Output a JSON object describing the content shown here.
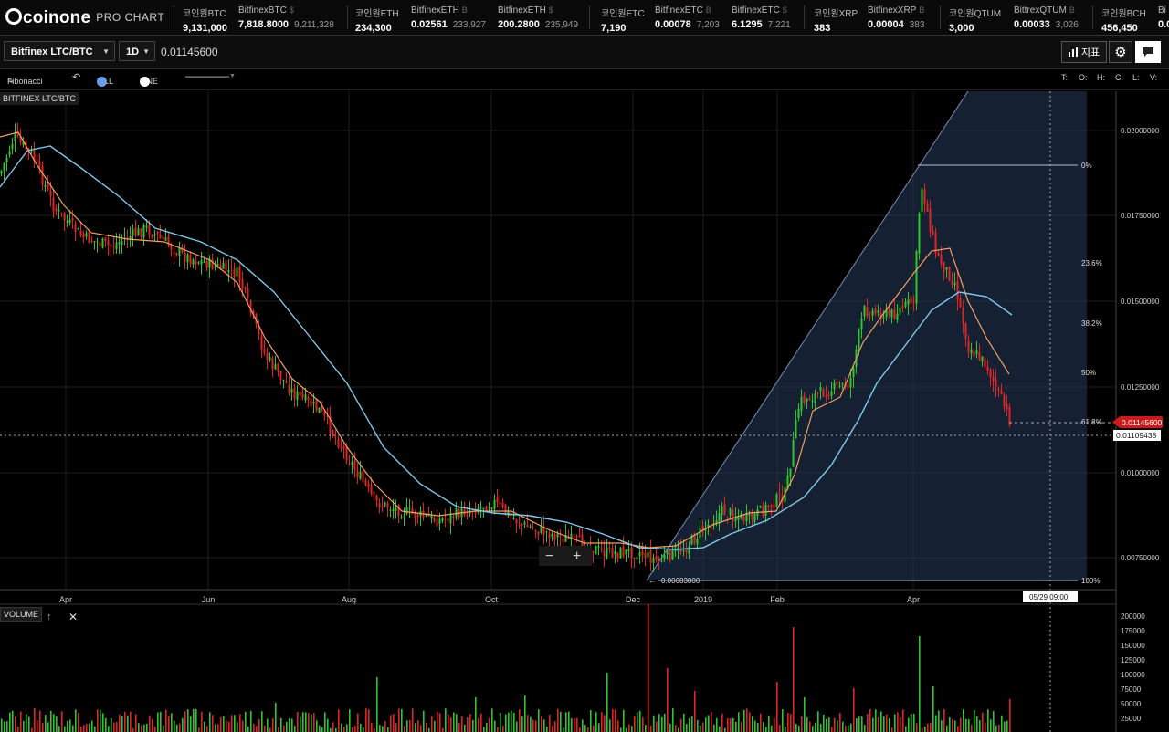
{
  "header": {
    "logo_text": "coinone",
    "logo_sub": "PRO CHART",
    "tickers": [
      {
        "name": "코인원BTC",
        "cur": "",
        "price": "9,131,000",
        "sub": ""
      },
      {
        "name": "BitfinexBTC",
        "cur": "$",
        "price": "7,818.8000",
        "sub": "9,211,328"
      },
      {
        "name": "코인원ETH",
        "cur": "",
        "price": "234,300",
        "sub": ""
      },
      {
        "name": "BitfinexETH",
        "cur": "B",
        "price": "0.02561",
        "sub": "233,927"
      },
      {
        "name": "BitfinexETH",
        "cur": "$",
        "price": "200.2800",
        "sub": "235,949"
      },
      {
        "name": "코인원ETC",
        "cur": "",
        "price": "7,190",
        "sub": ""
      },
      {
        "name": "BitfinexETC",
        "cur": "B",
        "price": "0.00078",
        "sub": "7,203"
      },
      {
        "name": "BitfinexETC",
        "cur": "$",
        "price": "6.1295",
        "sub": "7,221"
      },
      {
        "name": "코인원XRP",
        "cur": "",
        "price": "383",
        "sub": ""
      },
      {
        "name": "BitfinexXRP",
        "cur": "B",
        "price": "0.00004",
        "sub": "383"
      },
      {
        "name": "코인원QTUM",
        "cur": "",
        "price": "3,000",
        "sub": ""
      },
      {
        "name": "BittrexQTUM",
        "cur": "B",
        "price": "0.00033",
        "sub": "3,026"
      },
      {
        "name": "코인원BCH",
        "cur": "",
        "price": "456,450",
        "sub": ""
      },
      {
        "name": "Bi",
        "cur": "",
        "price": "0.0",
        "sub": ""
      }
    ]
  },
  "controls": {
    "symbol": "Bitfinex LTC/BTC",
    "interval": "1D",
    "price": "0.01145600",
    "indicator_btn": "지표"
  },
  "toolbar": {
    "tool": "Fibonacci",
    "fill": "FILL",
    "line": "LINE",
    "ohlc": [
      "T:",
      "O:",
      "H:",
      "C:",
      "L:",
      "V:"
    ]
  },
  "chart": {
    "label": "BITFINEX LTC/BTC",
    "volume_label": "VOLUME",
    "price_ticks": [
      "0.02000000",
      "0.01750000",
      "0.01500000",
      "0.01250000",
      "0.01000000",
      "0.00750000"
    ],
    "x_labels": [
      "Apr",
      "Jun",
      "Aug",
      "Oct",
      "Dec",
      "2019",
      "Feb",
      "Apr"
    ],
    "fib_levels": [
      "0%",
      "23.6%",
      "38.2%",
      "50%",
      "61.8%",
      "100%"
    ],
    "low_label": "0.00683000",
    "last_price": "0.01145600",
    "crosshair_price": "0.01109438",
    "crosshair_date": "05/29 09:00",
    "vol_ticks": [
      "200000",
      "175000",
      "150000",
      "125000",
      "100000",
      "75000",
      "50000",
      "25000"
    ],
    "colors": {
      "up": "#2ec52e",
      "down": "#e02424",
      "ma_fast": "#f0a060",
      "ma_slow": "#7ec8e8",
      "fib_fill": "#2a3a5a"
    }
  }
}
